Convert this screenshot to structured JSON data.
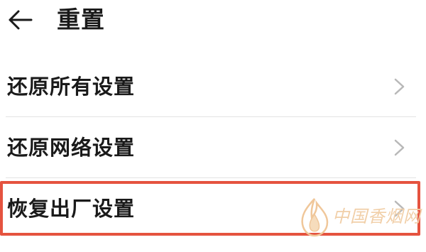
{
  "header": {
    "title": "重置"
  },
  "items": [
    {
      "label": "还原所有设置"
    },
    {
      "label": "还原网络设置"
    },
    {
      "label": "恢复出厂设置"
    }
  ],
  "watermark": {
    "text": "中国香烟网"
  },
  "colors": {
    "highlight": "#e5533f",
    "watermark": "#f1cfa8"
  }
}
